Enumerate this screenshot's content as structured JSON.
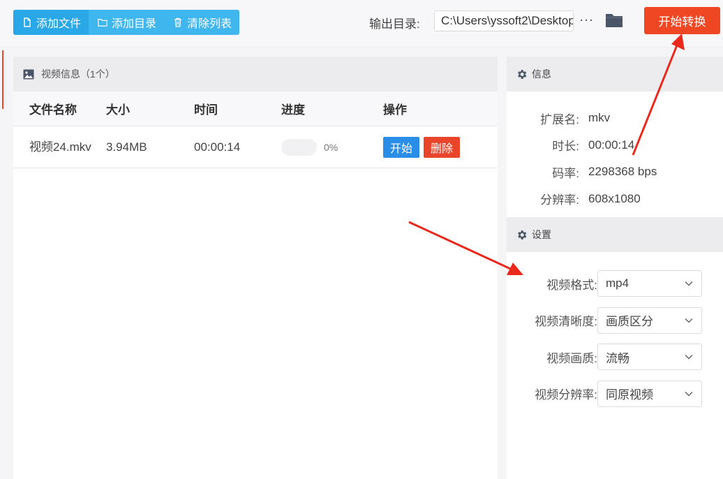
{
  "toolbar": {
    "add_file": "添加文件",
    "add_dir": "添加目录",
    "clear_list": "清除列表",
    "output_label": "输出目录:",
    "output_path": "C:\\Users\\yssoft2\\Desktop",
    "more": "···",
    "start_convert": "开始转换"
  },
  "video_panel": {
    "title": "视频信息（1个）",
    "columns": [
      "文件名称",
      "大小",
      "时间",
      "进度",
      "操作"
    ],
    "rows": [
      {
        "name": "视频24.mkv",
        "size": "3.94MB",
        "time": "00:00:14",
        "progress": 0,
        "progress_label": "0%",
        "start": "开始",
        "delete": "删除"
      }
    ]
  },
  "info_panel": {
    "title": "信息",
    "items": [
      {
        "key": "扩展名:",
        "value": "mkv"
      },
      {
        "key": "时长:",
        "value": "00:00:14"
      },
      {
        "key": "码率:",
        "value": "2298368 bps"
      },
      {
        "key": "分辨率:",
        "value": "608x1080"
      }
    ]
  },
  "settings_panel": {
    "title": "设置",
    "items": [
      {
        "key": "视频格式:",
        "value": "mp4"
      },
      {
        "key": "视频清晰度:",
        "value": "画质区分"
      },
      {
        "key": "视频画质:",
        "value": "流畅"
      },
      {
        "key": "视频分辨率:",
        "value": "同原视频"
      }
    ]
  },
  "colors": {
    "accent_red": "#ef4724",
    "blue_button": "#2a8ee8",
    "toolbar_blue": "#3fb6ee",
    "arrow": "#e8291c"
  }
}
